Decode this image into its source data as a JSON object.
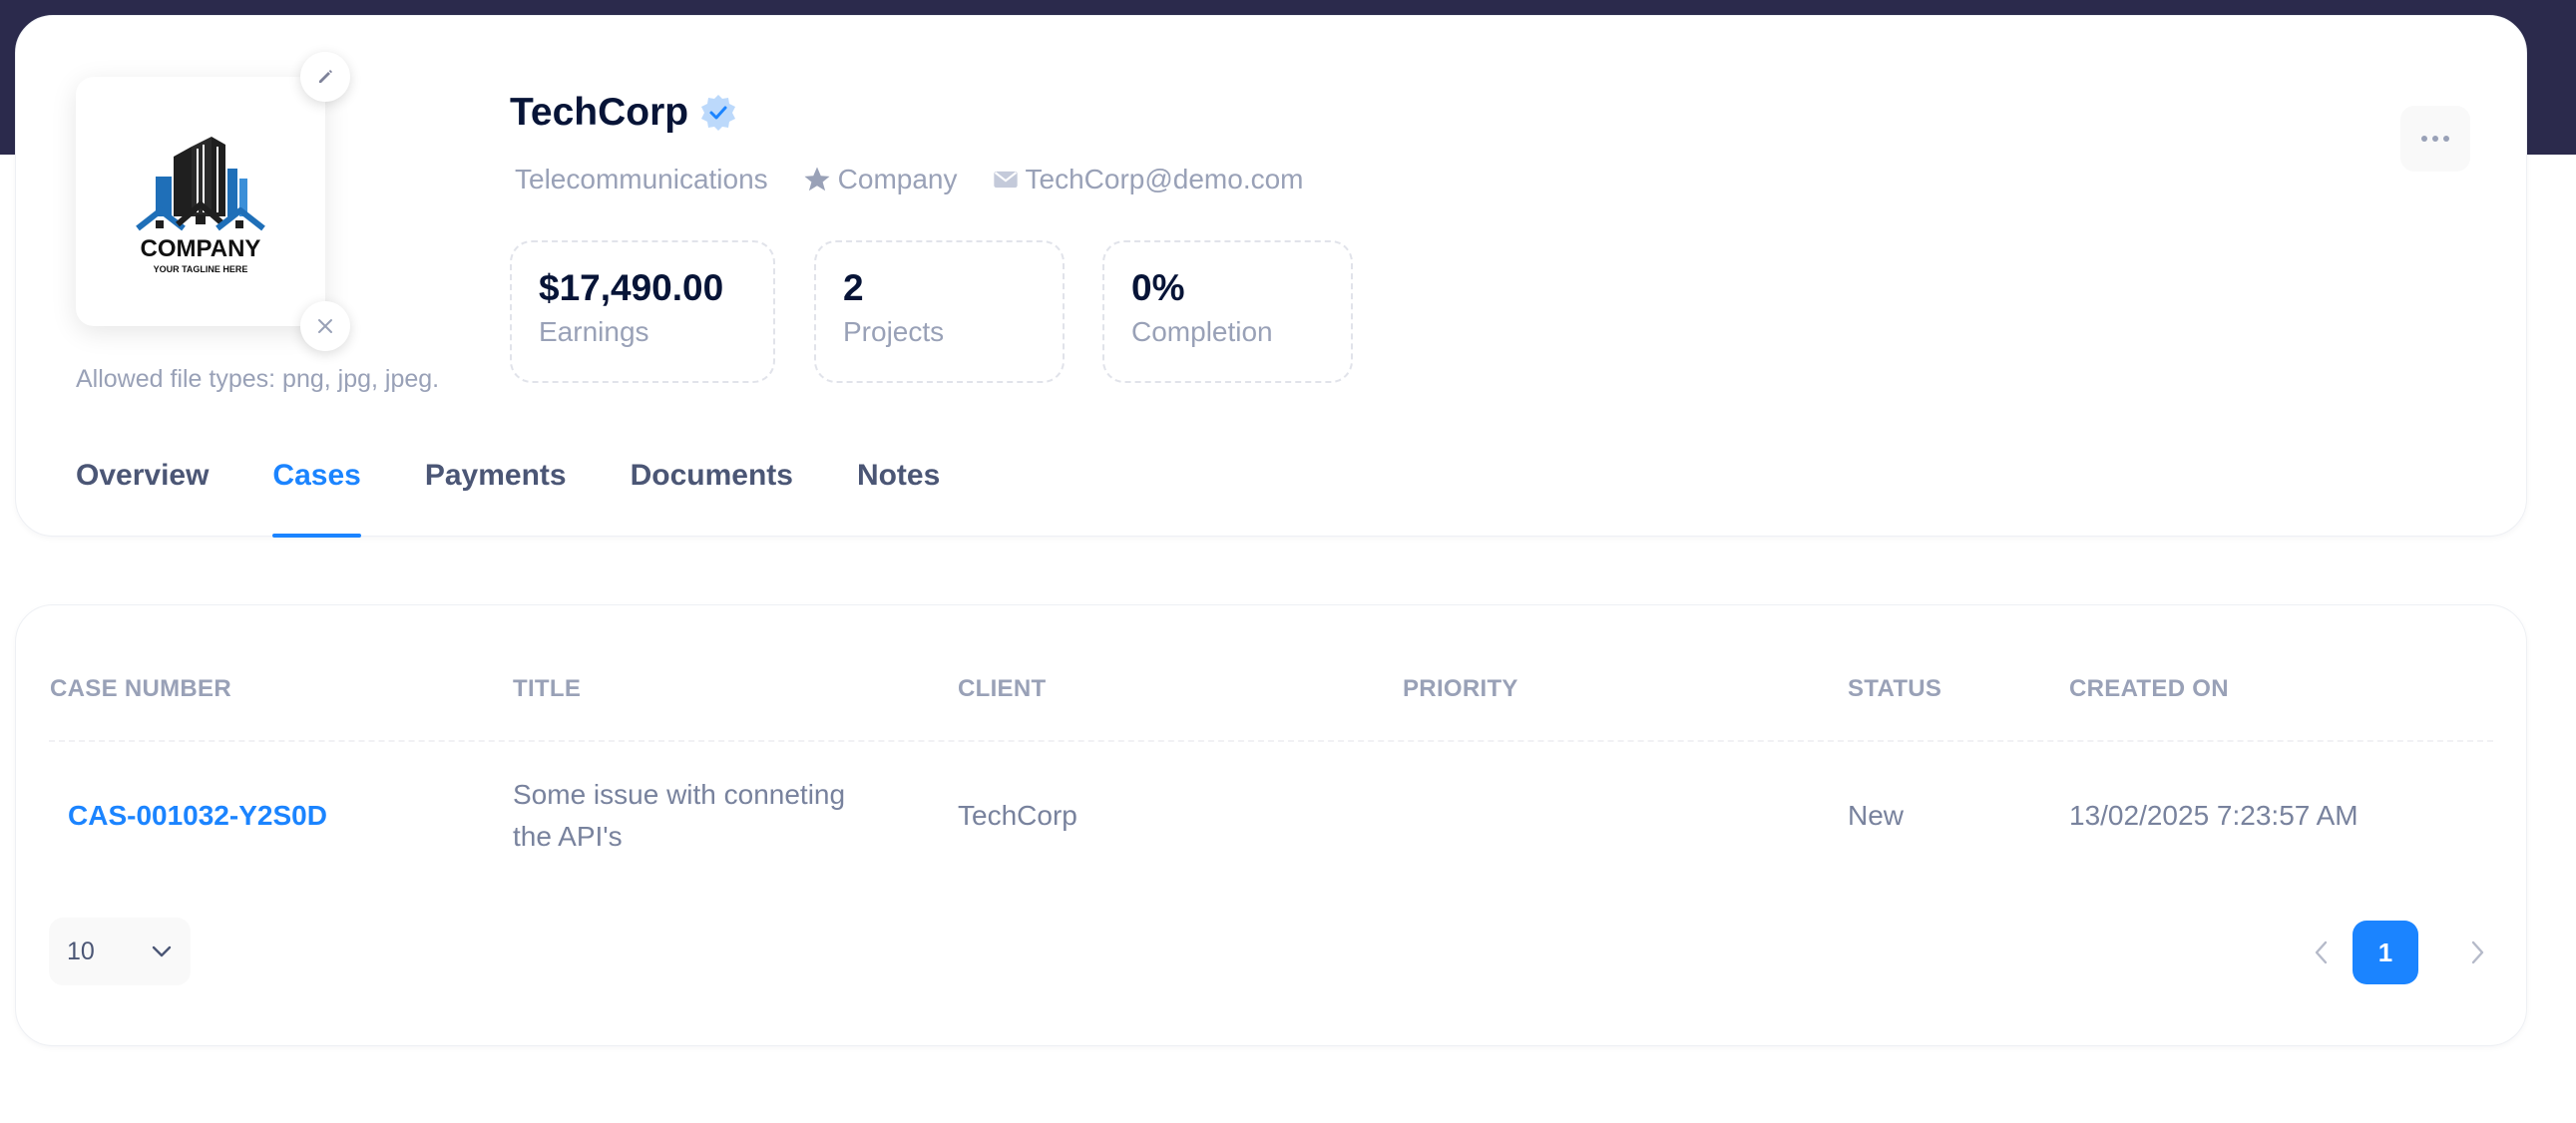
{
  "profile": {
    "name": "TechCorp",
    "industry": "Telecommunications",
    "type": "Company",
    "email": "TechCorp@demo.com",
    "logo": {
      "title": "COMPANY",
      "tagline": "YOUR TAGLINE HERE"
    },
    "file_hint": "Allowed file types: png, jpg, jpeg."
  },
  "stats": [
    {
      "value": "$17,490.00",
      "label": "Earnings"
    },
    {
      "value": "2",
      "label": "Projects"
    },
    {
      "value": "0%",
      "label": "Completion"
    }
  ],
  "tabs": [
    {
      "label": "Overview"
    },
    {
      "label": "Cases",
      "active": true
    },
    {
      "label": "Payments"
    },
    {
      "label": "Documents"
    },
    {
      "label": "Notes"
    }
  ],
  "table": {
    "columns": [
      "CASE NUMBER",
      "TITLE",
      "CLIENT",
      "PRIORITY",
      "STATUS",
      "CREATED ON"
    ],
    "rows": [
      {
        "case_number": "CAS-001032-Y2S0D",
        "title_line1": "Some issue with conneting",
        "title_line2": "the API's",
        "client": "TechCorp",
        "priority": "",
        "status": "New",
        "created_on": "13/02/2025 7:23:57 AM"
      }
    ]
  },
  "pagination": {
    "page_size": "10",
    "current_page": "1"
  },
  "icons": {
    "edit": "pencil-icon",
    "remove": "close-icon",
    "verified": "verified-badge-icon",
    "type": "star-icon",
    "email": "envelope-icon",
    "more": "ellipsis-icon"
  },
  "colors": {
    "primary": "#1b84ff",
    "header_band": "#2b2a4c",
    "muted_text": "#99a1b7"
  }
}
